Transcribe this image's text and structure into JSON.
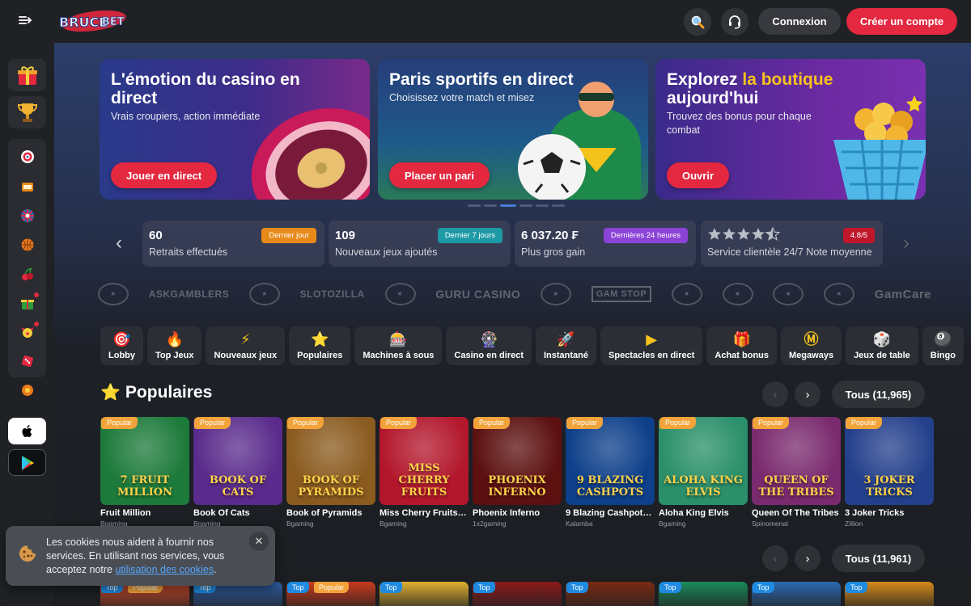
{
  "header": {
    "logo_text": "BRUCEBET",
    "login_label": "Connexion",
    "register_label": "Créer un compte",
    "icons": [
      "menu-toggle-icon",
      "search-icon",
      "support-headset-icon"
    ]
  },
  "sidebar": {
    "top_items": [
      "gift-icon",
      "trophy-icon"
    ],
    "group_items": [
      "target-icon",
      "slot-machine-icon",
      "roulette-icon",
      "basketball-icon",
      "cherry-icon",
      "gift-box-icon",
      "clown-icon",
      "dice-icon",
      "blossom-icon"
    ],
    "stores": [
      "apple-icon",
      "google-play-icon"
    ]
  },
  "banners": [
    {
      "title": "L'émotion du casino en direct",
      "subtitle": "Vrais croupiers, action immédiate",
      "cta": "Jouer en direct"
    },
    {
      "title": "Paris sportifs en direct",
      "subtitle": "Choisissez votre match et misez",
      "cta": "Placer un pari"
    },
    {
      "title_pre": "Explorez ",
      "title_accent": "la boutique",
      "title_post": "aujourd'hui",
      "subtitle": "Trouvez des bonus pour chaque combat",
      "cta": "Ouvrir"
    }
  ],
  "stats": [
    {
      "value": "60",
      "label": "Retraits effectués",
      "tag": "Dernier jour",
      "tag_color": "#e88a1a"
    },
    {
      "value": "109",
      "label": "Nouveaux jeux ajoutés",
      "tag": "Dernier 7 jours",
      "tag_color": "#1e9aa6"
    },
    {
      "value": "6 037.20 ₣",
      "label": "Plus gros gain",
      "tag": "Dernières 24 heures",
      "tag_color": "#8b43d6"
    },
    {
      "value": "",
      "label": "Service clientèle 24/7 Note moyenne",
      "tag": "4.8/5",
      "tag_color": "#c0172b",
      "rating": 4.5
    }
  ],
  "partners": [
    "ASKGAMBLERS",
    "SLOTOZILLA",
    "GURU CASINO",
    "GAM STOP",
    "GamCare"
  ],
  "categories": [
    {
      "label": "Lobby",
      "icon": "🎯"
    },
    {
      "label": "Top Jeux",
      "icon": "🔥"
    },
    {
      "label": "Nouveaux jeux",
      "icon": "⚡"
    },
    {
      "label": "Populaires",
      "icon": "⭐"
    },
    {
      "label": "Machines à sous",
      "icon": "🎰"
    },
    {
      "label": "Casino en direct",
      "icon": "🎡"
    },
    {
      "label": "Instantané",
      "icon": "🚀"
    },
    {
      "label": "Spectacles en direct",
      "icon": "▶"
    },
    {
      "label": "Achat bonus",
      "icon": "🎁"
    },
    {
      "label": "Megaways",
      "icon": "Ⓜ"
    },
    {
      "label": "Jeux de table",
      "icon": "🎲"
    },
    {
      "label": "Bingo",
      "icon": "🎱"
    }
  ],
  "popular": {
    "title": "Populaires",
    "all_label": "Tous (11,965)",
    "badge": "Popular",
    "games": [
      {
        "name": "Fruit Million",
        "provider": "Bgaming",
        "art": "7 FRUIT MILLION",
        "bg": "#1c7a3a"
      },
      {
        "name": "Book Of Cats",
        "provider": "Bgaming",
        "art": "BOOK OF CATS",
        "bg": "#5a2b8c"
      },
      {
        "name": "Book of Pyramids",
        "provider": "Bgaming",
        "art": "BOOK OF PYRAMIDS",
        "bg": "#8a5a1e"
      },
      {
        "name": "Miss Cherry Fruits J...",
        "provider": "Bgaming",
        "art": "MISS CHERRY FRUITS",
        "bg": "#b3172c"
      },
      {
        "name": "Phoenix Inferno",
        "provider": "1x2gaming",
        "art": "PHOENIX INFERNO",
        "bg": "#5c1010"
      },
      {
        "name": "9 Blazing Cashpots ...",
        "provider": "Kalamba",
        "art": "9 BLAZING CASHPOTS",
        "bg": "#0d3f8a"
      },
      {
        "name": "Aloha King Elvis",
        "provider": "Bgaming",
        "art": "ALOHA KING ELVIS",
        "bg": "#2a8f6a"
      },
      {
        "name": "Queen Of The Tribes",
        "provider": "Spinomenal",
        "art": "QUEEN OF THE TRIBES",
        "bg": "#7a2a6e"
      },
      {
        "name": "3 Joker Tricks",
        "provider": "Zillion",
        "art": "3 JOKER TRICKS",
        "bg": "#24408c"
      }
    ]
  },
  "top": {
    "all_label": "Tous (11,961)",
    "badge": "Top",
    "badge2": "Popular",
    "bgs": [
      "#d14a2a",
      "#2e5ea8",
      "#c93a1c",
      "#e0b030",
      "#8a1a1a",
      "#7a2a12",
      "#1a8a5a",
      "#2a6ab0",
      "#d68a1a"
    ]
  },
  "cookie": {
    "text": "Les cookies nous aident à fournir nos services. En utilisant nos services, vous acceptez notre ",
    "link": "utilisation des cookies",
    "end": "."
  }
}
